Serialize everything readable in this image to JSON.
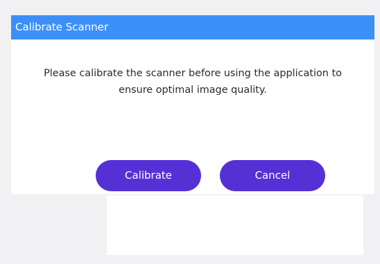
{
  "dialog": {
    "title": "Calibrate Scanner",
    "message_line1": "Please calibrate the scanner before using the application to",
    "message_line2": "ensure optimal image quality.",
    "buttons": {
      "calibrate_label": "Calibrate",
      "cancel_label": "Cancel"
    }
  },
  "colors": {
    "titlebar": "#3d8ff8",
    "button": "#5531d5",
    "background": "#f1f1f3",
    "dialog": "#ffffff",
    "message_text": "#2a2a2a"
  }
}
